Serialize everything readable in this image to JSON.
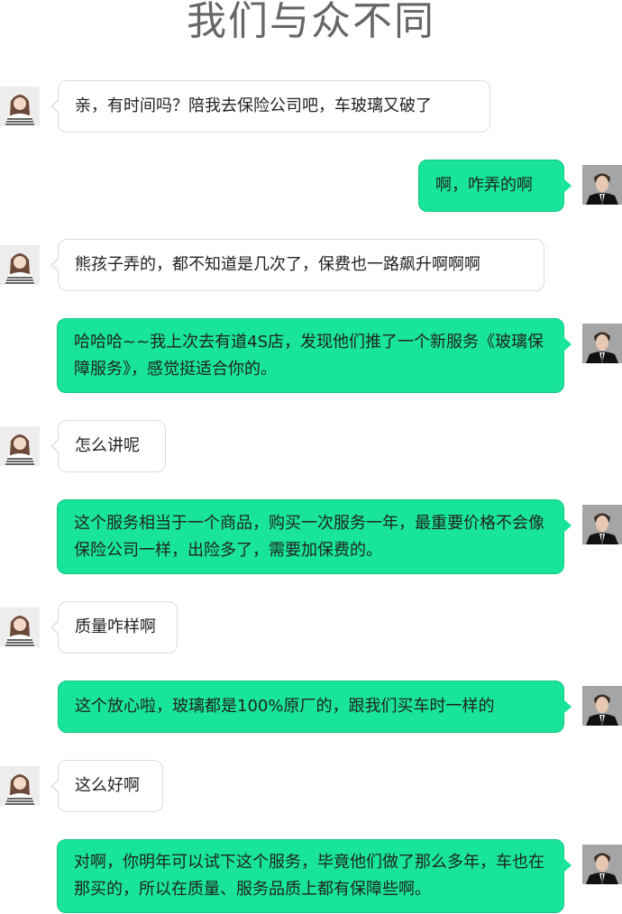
{
  "page": {
    "title": "我们与众不同"
  },
  "colors": {
    "right_bubble": "#18e599",
    "left_bubble": "#ffffff",
    "title": "#666666"
  },
  "avatars": {
    "her": "woman-avatar-icon",
    "him": "man-avatar-icon"
  },
  "messages": [
    {
      "sender": "her",
      "text": "亲，有时间吗？陪我去保险公司吧，车玻璃又破了"
    },
    {
      "sender": "him",
      "text": "啊，咋弄的啊"
    },
    {
      "sender": "her",
      "text": "熊孩子弄的，都不知道是几次了，保费也一路飙升啊啊啊"
    },
    {
      "sender": "him",
      "text": "哈哈哈~~我上次去有道4S店，发现他们推了一个新服务《玻璃保障服务》，感觉挺适合你的。"
    },
    {
      "sender": "her",
      "text": "怎么讲呢"
    },
    {
      "sender": "him",
      "text": "这个服务相当于一个商品，购买一次服务一年，最重要价格不会像保险公司一样，出险多了，需要加保费的。"
    },
    {
      "sender": "her",
      "text": "质量咋样啊"
    },
    {
      "sender": "him",
      "text": "这个放心啦，玻璃都是100%原厂的，跟我们买车时一样的"
    },
    {
      "sender": "her",
      "text": "这么好啊"
    },
    {
      "sender": "him",
      "text": "对啊，你明年可以试下这个服务，毕竟他们做了那么多年，车也在那买的，所以在质量、服务品质上都有保障些啊。"
    }
  ]
}
